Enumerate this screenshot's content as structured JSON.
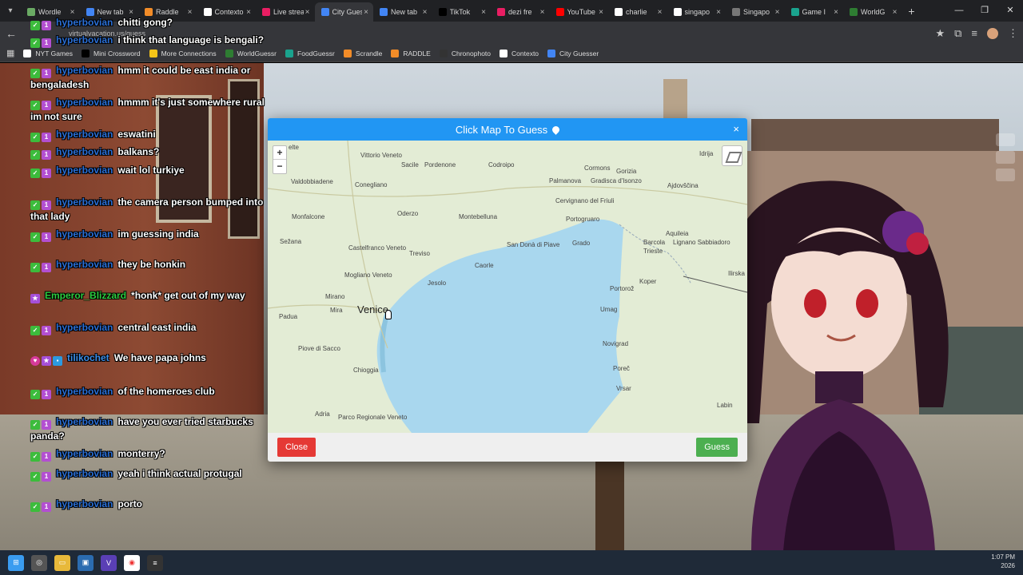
{
  "browser": {
    "tabs": [
      {
        "label": "Wordle",
        "color": "#6aaa64",
        "active": false
      },
      {
        "label": "New tab",
        "color": "#4285f4",
        "active": false
      },
      {
        "label": "Raddle",
        "color": "#f28c28",
        "active": false
      },
      {
        "label": "Contexto",
        "color": "#ffffff",
        "active": false
      },
      {
        "label": "Live stream",
        "color": "#e91e63",
        "active": false
      },
      {
        "label": "City Guesser",
        "color": "#4285f4",
        "active": true
      },
      {
        "label": "New tab",
        "color": "#4285f4",
        "active": false
      },
      {
        "label": "TikTok",
        "color": "#000000",
        "active": false
      },
      {
        "label": "dezi fre",
        "color": "#e91e63",
        "active": false
      },
      {
        "label": "YouTube",
        "color": "#ff0000",
        "active": false
      },
      {
        "label": "charlie",
        "color": "#ffffff",
        "active": false
      },
      {
        "label": "singapo",
        "color": "#ffffff",
        "active": false
      },
      {
        "label": "Singapo",
        "color": "#777777",
        "active": false
      },
      {
        "label": "Game I",
        "color": "#1aa38e",
        "active": false
      },
      {
        "label": "WorldG",
        "color": "#2e7d32",
        "active": false
      }
    ],
    "url": "virtualvacation.us/guess",
    "bookmarks": [
      {
        "label": "NYT Games",
        "color": "#ffffff"
      },
      {
        "label": "Mini Crossword",
        "color": "#000000"
      },
      {
        "label": "More Connections",
        "color": "#f5c518"
      },
      {
        "label": "WorldGuessr",
        "color": "#2e7d32"
      },
      {
        "label": "FoodGuessr",
        "color": "#1aa38e"
      },
      {
        "label": "Scrandle",
        "color": "#f28c28"
      },
      {
        "label": "RADDLE",
        "color": "#f28c28"
      },
      {
        "label": "Chronophoto",
        "color": "#333333"
      },
      {
        "label": "Contexto",
        "color": "#ffffff"
      },
      {
        "label": "City Guesser",
        "color": "#4285f4"
      }
    ]
  },
  "chat": [
    {
      "user": "hyperbovian",
      "text": "chitti gong?",
      "badges": [
        "check",
        "sub"
      ]
    },
    {
      "user": "hyperbovian",
      "text": "i think that language is bengali?",
      "badges": [
        "check",
        "sub"
      ]
    },
    {
      "user": "hyperbovian",
      "text": "hmm it could be east india or bengaladesh",
      "badges": [
        "check",
        "sub"
      ]
    },
    {
      "user": "hyperbovian",
      "text": "hmmm it's just somewhere rural im not sure",
      "badges": [
        "check",
        "sub"
      ]
    },
    {
      "user": "hyperbovian",
      "text": "eswatini",
      "badges": [
        "check",
        "sub"
      ]
    },
    {
      "user": "hyperbovian",
      "text": "balkans?",
      "badges": [
        "check",
        "sub"
      ]
    },
    {
      "user": "hyperbovian",
      "text": "wait lol turkiye",
      "badges": [
        "check",
        "sub"
      ]
    },
    {
      "user": "hyperbovian",
      "text": "the camera person bumped into that lady",
      "badges": [
        "check",
        "sub"
      ]
    },
    {
      "user": "hyperbovian",
      "text": "im guessing india",
      "badges": [
        "check",
        "sub"
      ]
    },
    {
      "user": "hyperbovian",
      "text": "they be honkin",
      "badges": [
        "check",
        "sub"
      ]
    },
    {
      "user": "Emperor_Blizzard",
      "text": "*honk* get out of my way",
      "badges": [
        "star"
      ]
    },
    {
      "user": "hyperbovian",
      "text": "central east india",
      "badges": [
        "check",
        "sub"
      ]
    },
    {
      "user": "tilikochet",
      "text": "We have papa johns",
      "badges": [
        "heart",
        "star",
        "mod"
      ]
    },
    {
      "user": "hyperbovian",
      "text": "of the homeroes club",
      "badges": [
        "check",
        "sub"
      ]
    },
    {
      "user": "hyperbovian",
      "text": "have you ever tried starbucks panda?",
      "badges": [
        "check",
        "sub"
      ]
    },
    {
      "user": "hyperbovian",
      "text": "monterry?",
      "badges": [
        "check",
        "sub"
      ]
    },
    {
      "user": "hyperbovian",
      "text": "yeah i think actual protugal",
      "badges": [
        "check",
        "sub"
      ]
    },
    {
      "user": "hyperbovian",
      "text": "porto",
      "badges": [
        "check",
        "sub"
      ]
    }
  ],
  "modal": {
    "title": "Click Map To Guess",
    "close_x": "×",
    "zoom_in": "+",
    "zoom_out": "−",
    "close_label": "Close",
    "guess_label": "Guess",
    "map_labels": [
      "Vittorio Veneto",
      "Sacile",
      "Pordenone",
      "Codroipo",
      "Cormons",
      "Gorizia",
      "Idrija",
      "Valdobbiadene",
      "Conegliano",
      "Palmanova",
      "Gradisca d'Isonzo",
      "Ajdovščina",
      "Oderzo",
      "Cervignano del Friuli",
      "Monfalcone",
      "Montebelluna",
      "Portogruaro",
      "Aquileia",
      "Sežana",
      "Castelfranco Veneto",
      "Treviso",
      "San Donà di Piave",
      "Lignano Sabbiadoro",
      "Grado",
      "Barcola",
      "Trieste",
      "Caorle",
      "Mogliano Veneto",
      "Jesolo",
      "Koper",
      "Ilirska",
      "Mirano",
      "Venice",
      "Portorož",
      "Padua",
      "Mira",
      "Umag",
      "Piove di Sacco",
      "Novigrad",
      "Chioggia",
      "Poreč",
      "Vrsar",
      "Adria",
      "Parco Regionale Veneto",
      "Labin",
      "elte"
    ]
  },
  "taskbar": {
    "time": "1:07 PM",
    "date": "2026"
  }
}
